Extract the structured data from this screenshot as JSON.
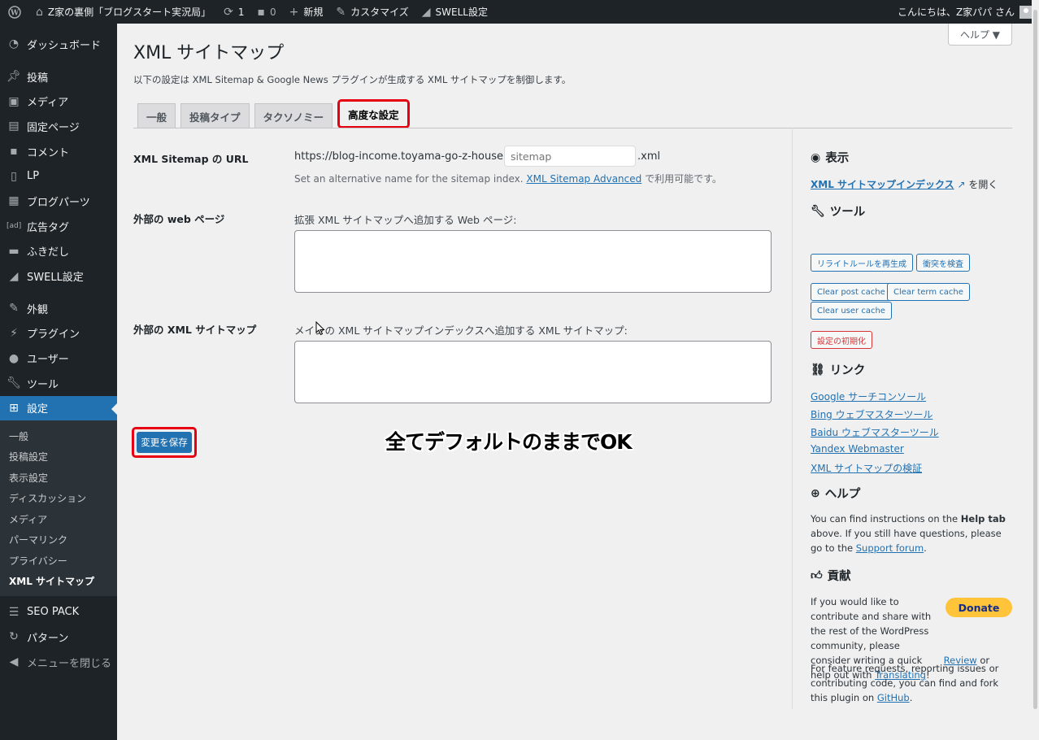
{
  "adminbar": {
    "site_name": "Z家の裏側「ブログスタート実況局」",
    "updates_count": "1",
    "comments_count": "0",
    "new_label": "新規",
    "customize_label": "カスタマイズ",
    "swell_label": "SWELL設定",
    "greeting": "こんにちは、Z家パパ さん"
  },
  "menu": {
    "items": [
      {
        "label": "ダッシュボード",
        "icon": "dashboard-icon"
      },
      {
        "label": "投稿",
        "icon": "pin-icon"
      },
      {
        "label": "メディア",
        "icon": "media-icon"
      },
      {
        "label": "固定ページ",
        "icon": "page-icon"
      },
      {
        "label": "コメント",
        "icon": "comment-icon"
      },
      {
        "label": "LP",
        "icon": "document-icon"
      },
      {
        "label": "ブログパーツ",
        "icon": "blocks-icon"
      },
      {
        "label": "広告タグ",
        "icon": "ad-icon"
      },
      {
        "label": "ふきだし",
        "icon": "bubble-icon"
      },
      {
        "label": "SWELL設定",
        "icon": "swell-icon"
      },
      {
        "label": "外観",
        "icon": "brush-icon"
      },
      {
        "label": "プラグイン",
        "icon": "plugin-icon"
      },
      {
        "label": "ユーザー",
        "icon": "user-icon"
      },
      {
        "label": "ツール",
        "icon": "wrench-icon"
      },
      {
        "label": "設定",
        "icon": "settings-icon"
      }
    ],
    "submenu": [
      "一般",
      "投稿設定",
      "表示設定",
      "ディスカッション",
      "メディア",
      "パーマリンク",
      "プライバシー",
      "XML サイトマップ"
    ],
    "after": [
      {
        "label": "SEO PACK",
        "icon": "list-icon"
      },
      {
        "label": "パターン",
        "icon": "pattern-icon"
      }
    ],
    "collapse": "メニューを閉じる"
  },
  "help_label": "ヘルプ ▼",
  "page": {
    "title": "XML サイトマップ",
    "description": "以下の設定は XML Sitemap & Google News プラグインが生成する XML サイトマップを制御します。",
    "tabs": [
      "一般",
      "投稿タイプ",
      "タクソノミー",
      "高度な設定"
    ]
  },
  "form": {
    "url_label": "XML Sitemap の URL",
    "url_prefix": "https://blog-income.toyama-go-z-house.com/",
    "url_placeholder": "sitemap",
    "url_suffix": ".xml",
    "url_help_pre": "Set an alternative name for the sitemap index.",
    "url_help_link": "XML Sitemap Advanced",
    "url_help_post": "で利用可能です。",
    "web_label": "外部の web ページ",
    "web_hint": "拡張 XML サイトマップへ追加する Web ページ:",
    "xml_label": "外部の XML サイトマップ",
    "xml_hint": "メインの XML サイトマップインデックスへ追加する XML サイトマップ:",
    "save_label": "変更を保存",
    "annotation": "全てデフォルトのままでOK"
  },
  "sidebar": {
    "view_heading": "表示",
    "view_link": "XML サイトマップインデックス",
    "view_suffix": "を開く",
    "tools_heading": "ツール",
    "tools_buttons": [
      "リライトルールを再生成",
      "衝突を検査",
      "Clear post cache",
      "Clear term cache",
      "Clear user cache"
    ],
    "reset_button": "設定の初期化",
    "links_heading": "リンク",
    "links": [
      "Google サーチコンソール",
      "Bing ウェブマスターツール",
      "Baidu ウェブマスターツール",
      "Yandex Webmaster",
      "XML サイトマップの検証"
    ],
    "help_heading": "ヘルプ",
    "help_text_1": "You can find instructions on the",
    "help_text_bold": "Help tab",
    "help_text_2": "above. If you still have questions, please go to the",
    "help_link": "Support forum",
    "contrib_heading": "貢献",
    "contrib_text_1": "If you would like to contribute and share with the rest of the WordPress community, please consider writing a quick",
    "contrib_review": "Review",
    "contrib_text_2": "or help out with",
    "contrib_translating": "Translating",
    "donate_label": "Donate",
    "feature_text": "For feature requests, reporting issues or contributing code, you can find and fork this plugin on",
    "github_link": "GitHub"
  }
}
